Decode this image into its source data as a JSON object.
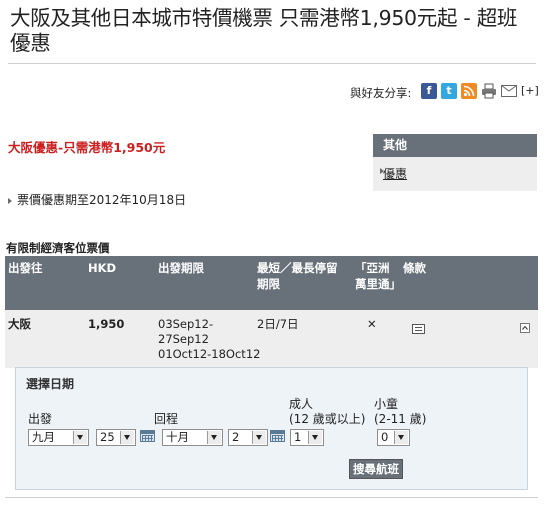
{
  "page": {
    "title": "大阪及其他日本城市特價機票 只需港幣1,950元起 - 超班優惠"
  },
  "share": {
    "label": "與好友分享:",
    "icons": [
      "facebook-icon",
      "twitter-icon",
      "rss-icon",
      "print-icon",
      "email-icon"
    ],
    "more": "[+]"
  },
  "promo": {
    "headline": "大阪優惠-只需港幣1,950元",
    "validity": "票價優惠期至2012年10月18日"
  },
  "sidebar": {
    "heading": "其他",
    "items": [
      {
        "label": "優惠"
      }
    ]
  },
  "fares": {
    "title": "有限制經濟客位票價",
    "headers": {
      "destination": "出發往",
      "currency": "HKD",
      "period": "出發期限",
      "stay": "最短／最長停留期限",
      "asia_miles": "「亞洲萬里通」",
      "terms": "條款"
    },
    "rows": [
      {
        "destination": "大阪",
        "price": "1,950",
        "period_line1": "03Sep12-",
        "period_line2": "27Sep12",
        "period_line3": "01Oct12-18Oct12",
        "stay": "2日/7日",
        "asia_miles": "✕"
      }
    ]
  },
  "date_picker": {
    "heading": "選擇日期",
    "depart_label": "出發",
    "return_label": "回程",
    "adult_label": "成人",
    "adult_sub": "(12 歲或以上)",
    "child_label": "小童",
    "child_sub": "(2-11 歲)",
    "depart_month": "九月",
    "depart_day": "25",
    "return_month": "十月",
    "return_day": "2",
    "adults": "1",
    "children": "0",
    "search_button": "搜尋航班"
  },
  "colors": {
    "header_bg": "#68717a",
    "row_bg": "#eeeeee",
    "promo_red": "#cc1f1f",
    "panel_bg": "#eef3f7"
  }
}
